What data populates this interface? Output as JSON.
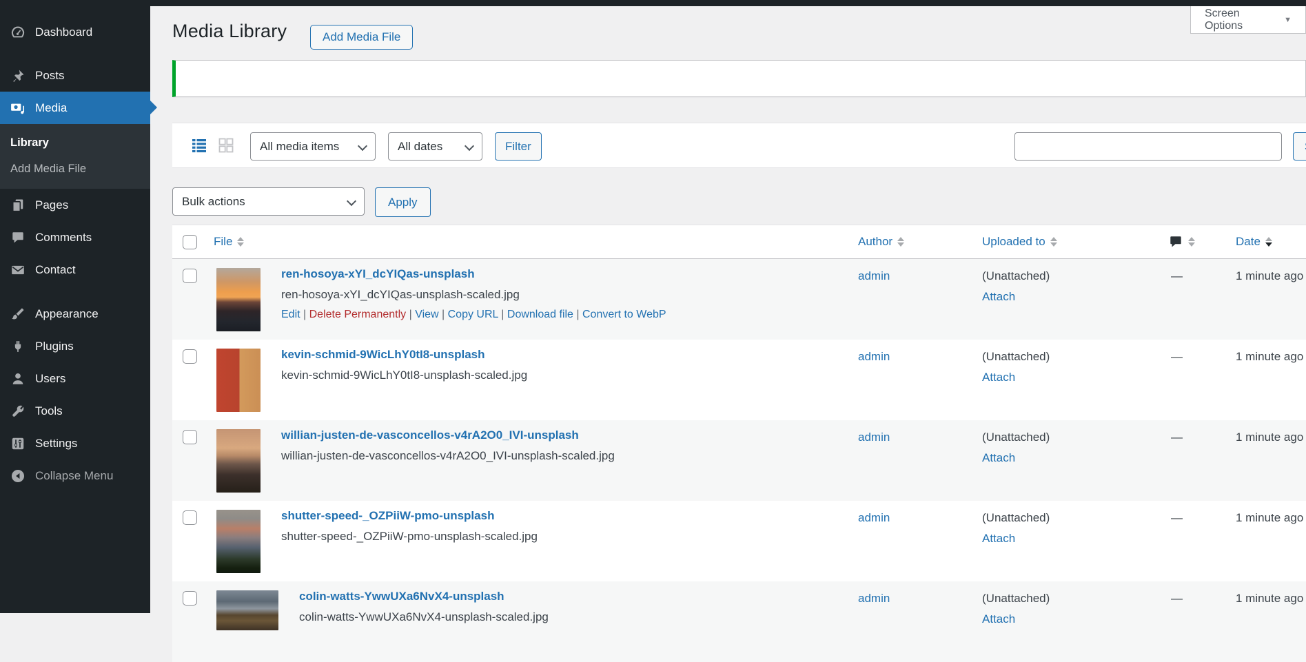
{
  "colors": {
    "accent_blue": "#2271b1",
    "success_green": "#00a32a",
    "danger_red": "#b32d2e",
    "sidebar_bg": "#1d2327",
    "page_bg": "#f0f0f1"
  },
  "screen_options": {
    "label": "Screen Options"
  },
  "sidebar": {
    "items": [
      {
        "label": "Dashboard",
        "icon": "dashboard-icon"
      },
      {
        "label": "Posts",
        "icon": "pin-icon",
        "gap": true
      },
      {
        "label": "Media",
        "icon": "media-icon",
        "active": true
      },
      {
        "label": "Pages",
        "icon": "pages-icon"
      },
      {
        "label": "Comments",
        "icon": "comments-icon"
      },
      {
        "label": "Contact",
        "icon": "contact-icon"
      },
      {
        "label": "Appearance",
        "icon": "appearance-icon",
        "gap2": true
      },
      {
        "label": "Plugins",
        "icon": "plugins-icon"
      },
      {
        "label": "Users",
        "icon": "users-icon"
      },
      {
        "label": "Tools",
        "icon": "tools-icon"
      },
      {
        "label": "Settings",
        "icon": "settings-icon"
      }
    ],
    "submenu": [
      {
        "label": "Library",
        "current": true
      },
      {
        "label": "Add Media File",
        "current": false
      }
    ],
    "collapse_label": "Collapse Menu"
  },
  "header": {
    "title": "Media Library",
    "add_button": "Add Media File"
  },
  "notice": {
    "type": "success",
    "message": ""
  },
  "toolbar": {
    "media_filter_value": "All media items",
    "date_filter_value": "All dates",
    "filter_button": "Filter",
    "search_value": "",
    "search_placeholder": "",
    "search_button": "Search Media Items"
  },
  "bulk": {
    "value": "Bulk actions",
    "apply_label": "Apply"
  },
  "table": {
    "headers": [
      {
        "id": "file",
        "label": "File",
        "sortable": true
      },
      {
        "id": "author",
        "label": "Author",
        "sortable": true
      },
      {
        "id": "uploaded",
        "label": "Uploaded to",
        "sortable": true
      },
      {
        "id": "comments",
        "icon": "comments-bubble-icon",
        "sortable": true
      },
      {
        "id": "date",
        "label": "Date",
        "sortable": true,
        "sorted": "desc"
      }
    ],
    "rows": [
      {
        "title": "ren-hosoya-xYI_dcYIQas-unsplash",
        "filename": "ren-hosoya-xYI_dcYIQas-unsplash-scaled.jpg",
        "author": "admin",
        "uploaded_to": "(Unattached)",
        "attach_label": "Attach",
        "comments": "—",
        "date": "1 minute ago",
        "thumb_shape": "portrait",
        "thumb_gradient": "linear-gradient(180deg,#b3a89c 0%,#cf9765 22%,#ee9e4d 38%,#f0a454 46%,#6b4438 54%,#2e2528 68%,#23262d 85%,#1b1e24 100%)",
        "actions": [
          {
            "label": "Edit",
            "danger": false
          },
          {
            "label": "Delete Permanently",
            "danger": true
          },
          {
            "label": "View",
            "danger": false
          },
          {
            "label": "Copy URL",
            "danger": false
          },
          {
            "label": "Download file",
            "danger": false
          },
          {
            "label": "Convert to WebP",
            "danger": false
          }
        ]
      },
      {
        "title": "kevin-schmid-9WicLhY0tI8-unsplash",
        "filename": "kevin-schmid-9WicLhY0tI8-unsplash-scaled.jpg",
        "author": "admin",
        "uploaded_to": "(Unattached)",
        "attach_label": "Attach",
        "comments": "—",
        "date": "1 minute ago",
        "thumb_shape": "portrait",
        "thumb_gradient": "linear-gradient(90deg,#c0452f 0%,#b8432e 52%,#d39a5c 52%,#cb8f55 100%),linear-gradient(180deg,#a9c5d7 0%,#b4cbd9 20%,rgba(0,0,0,0) 20%)",
        "actions": []
      },
      {
        "title": "willian-justen-de-vasconcellos-v4rA2O0_IVI-unsplash",
        "filename": "willian-justen-de-vasconcellos-v4rA2O0_IVI-unsplash-scaled.jpg",
        "author": "admin",
        "uploaded_to": "(Unattached)",
        "attach_label": "Attach",
        "comments": "—",
        "date": "1 minute ago",
        "thumb_shape": "portrait",
        "thumb_gradient": "linear-gradient(180deg,#c59574 0%,#d8a87f 30%,#b78a68 42%,#6d564a 55%,#3c302b 72%,#262019 100%)",
        "actions": []
      },
      {
        "title": "shutter-speed-_OZPiiW-pmo-unsplash",
        "filename": "shutter-speed-_OZPiiW-pmo-unsplash-scaled.jpg",
        "author": "admin",
        "uploaded_to": "(Unattached)",
        "attach_label": "Attach",
        "comments": "—",
        "date": "1 minute ago",
        "thumb_shape": "portrait",
        "thumb_gradient": "linear-gradient(180deg,#98928a 0%,#8f8c88 14%,#b97f68 30%,#8a7d7e 44%,#55606e 60%,#2c3a2a 78%,#15200f 92%,#101a10 100%)",
        "actions": []
      },
      {
        "title": "colin-watts-YwwUXa6NvX4-unsplash",
        "filename": "colin-watts-YwwUXa6NvX4-unsplash-scaled.jpg",
        "author": "admin",
        "uploaded_to": "(Unattached)",
        "attach_label": "Attach",
        "comments": "—",
        "date": "1 minute ago",
        "thumb_shape": "landscape",
        "thumb_gradient": "linear-gradient(180deg,#7d8894 0%,#5d6974 28%,#8e969e 46%,#57462f 62%,#6b5638 76%,#3e3226 100%)",
        "actions": []
      }
    ]
  }
}
